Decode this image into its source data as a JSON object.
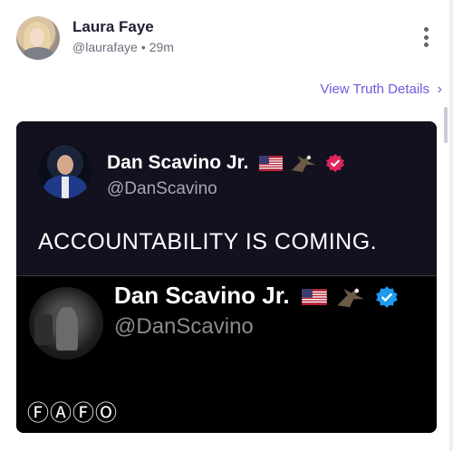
{
  "post": {
    "author_name": "Laura Faye",
    "handle": "@laurafaye",
    "separator": "•",
    "time": "29m",
    "details_link": "View Truth Details",
    "chevron": "›"
  },
  "tweet1": {
    "name": "Dan Scavino Jr.",
    "handle": "@DanScavino",
    "text": "ACCOUNTABILITY IS COMING.",
    "badge_color": "#e0245e",
    "icons": [
      "us-flag-icon",
      "eagle-icon",
      "verified-badge-icon"
    ]
  },
  "tweet2": {
    "name": "Dan Scavino Jr.",
    "handle": "@DanScavino",
    "text": "ⒻⒶⒻⓄ",
    "badge_color": "#1d9bf0",
    "icons": [
      "us-flag-icon",
      "eagle-icon",
      "verified-badge-icon"
    ]
  },
  "colors": {
    "link": "#6a5ce0",
    "card_top_bg": "#13111f",
    "card_bottom_bg": "#000000"
  }
}
